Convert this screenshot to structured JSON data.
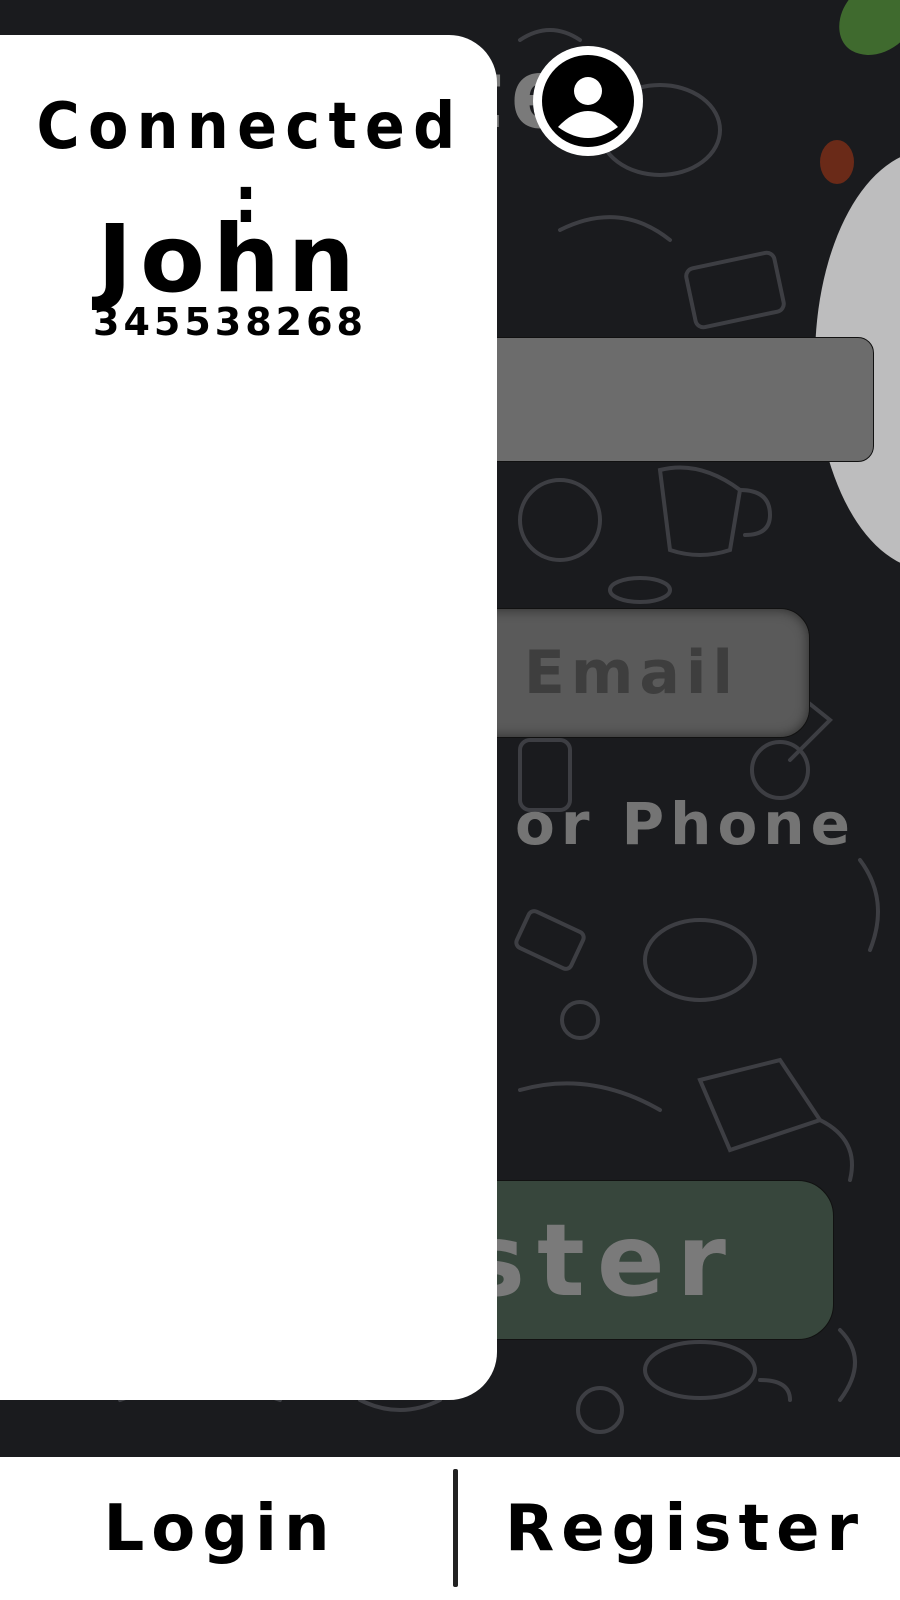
{
  "background": {
    "pattern": "food-doodle-pattern",
    "colors": {
      "base": "#1a1b1e",
      "doodle": "#4a4b50"
    }
  },
  "page": {
    "title_partial": "ster",
    "email_toggle_partial": "Email",
    "or_phone_partial": "or Phone",
    "submit_partial": "ster"
  },
  "drawer": {
    "connected_label": "Connected :",
    "user_name": "John",
    "user_phone": "345538268"
  },
  "header": {
    "account_icon": "account-circle-icon"
  },
  "bottom_nav": {
    "login_label": "Login",
    "register_label": "Register"
  }
}
